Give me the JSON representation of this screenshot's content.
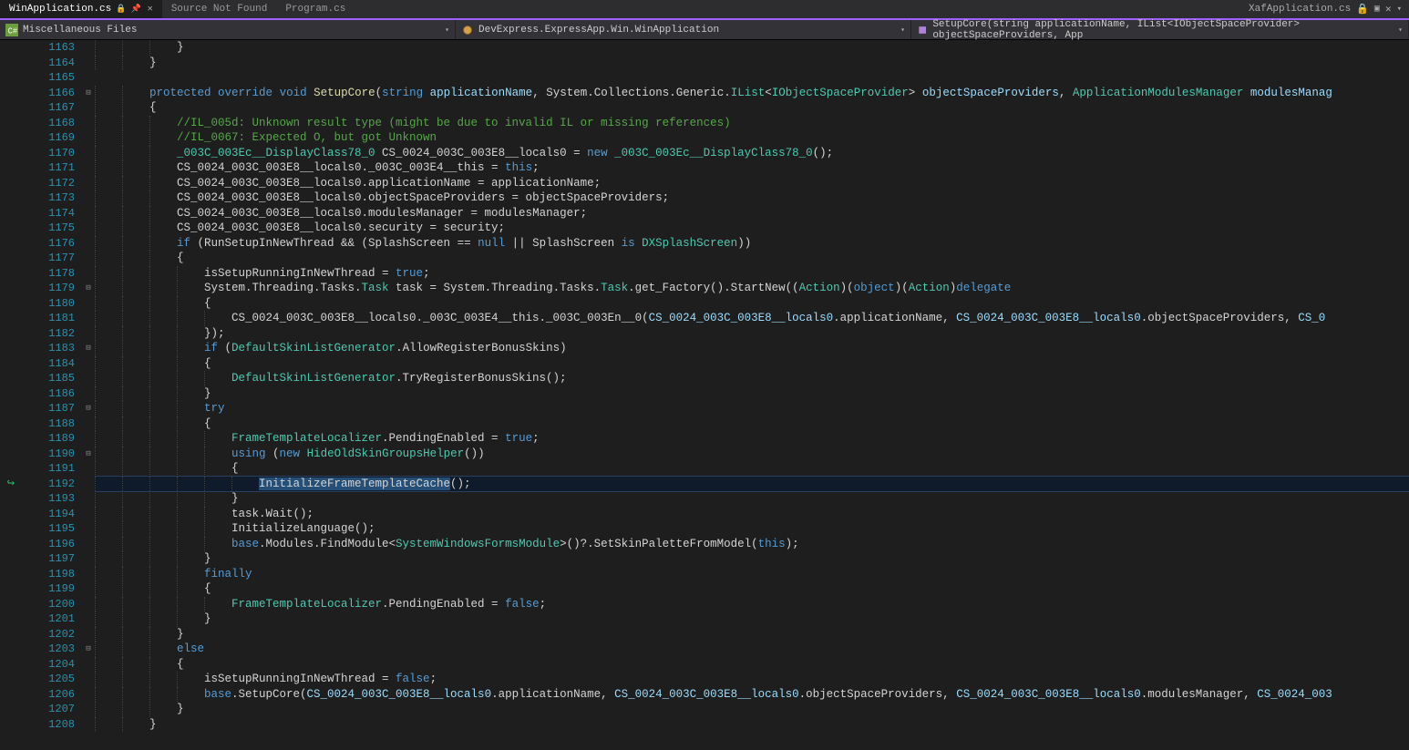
{
  "tabs": {
    "active": "WinApplication.cs",
    "items": [
      {
        "label": "WinApplication.cs",
        "active": true,
        "locked": true,
        "pinned": true
      },
      {
        "label": "Source Not Found",
        "active": false
      },
      {
        "label": "Program.cs",
        "active": false
      }
    ],
    "right": {
      "label": "XafApplication.cs",
      "locked": true
    }
  },
  "nav": {
    "project": "Miscellaneous Files",
    "class": "DevExpress.ExpressApp.Win.WinApplication",
    "method": "SetupCore(string applicationName, IList<IObjectSpaceProvider> objectSpaceProviders, App"
  },
  "icon_names": {
    "proj": "csharp-file-icon",
    "class": "class-icon",
    "method": "method-icon"
  },
  "code": {
    "first_line": 1163,
    "highlighted_line": 1192,
    "highlighted_text": "InitializeFrameTemplateCache",
    "fold_lines": [
      1166,
      1179,
      1183,
      1187,
      1190,
      1203
    ],
    "indicator_line": 1192,
    "lines": [
      {
        "n": 1163,
        "i": 3,
        "tok": [
          [
            "pl",
            "}"
          ]
        ]
      },
      {
        "n": 1164,
        "i": 2,
        "tok": [
          [
            "pl",
            "}"
          ]
        ]
      },
      {
        "n": 1165,
        "i": 0,
        "tok": []
      },
      {
        "n": 1166,
        "i": 2,
        "tok": [
          [
            "kw",
            "protected"
          ],
          [
            "pl",
            " "
          ],
          [
            "kw",
            "override"
          ],
          [
            "pl",
            " "
          ],
          [
            "kw",
            "void"
          ],
          [
            "pl",
            " "
          ],
          [
            "mc",
            "SetupCore"
          ],
          [
            "pl",
            "("
          ],
          [
            "kw",
            "string"
          ],
          [
            "pl",
            " "
          ],
          [
            "fld",
            "applicationName"
          ],
          [
            "pl",
            ", System.Collections.Generic."
          ],
          [
            "type",
            "IList"
          ],
          [
            "pl",
            "<"
          ],
          [
            "type",
            "IObjectSpaceProvider"
          ],
          [
            "pl",
            "> "
          ],
          [
            "fld",
            "objectSpaceProviders"
          ],
          [
            "pl",
            ", "
          ],
          [
            "type",
            "ApplicationModulesManager"
          ],
          [
            "pl",
            " "
          ],
          [
            "fld",
            "modulesManag"
          ]
        ]
      },
      {
        "n": 1167,
        "i": 2,
        "tok": [
          [
            "pl",
            "{"
          ]
        ]
      },
      {
        "n": 1168,
        "i": 3,
        "tok": [
          [
            "com",
            "//IL_005d: Unknown result type (might be due to invalid IL or missing references)"
          ]
        ]
      },
      {
        "n": 1169,
        "i": 3,
        "tok": [
          [
            "com",
            "//IL_0067: Expected O, but got Unknown"
          ]
        ]
      },
      {
        "n": 1170,
        "i": 3,
        "tok": [
          [
            "type",
            "_003C_003Ec__DisplayClass78_0"
          ],
          [
            "pl",
            " CS_0024_003C_003E8__locals0 = "
          ],
          [
            "kw",
            "new"
          ],
          [
            "pl",
            " "
          ],
          [
            "type",
            "_003C_003Ec__DisplayClass78_0"
          ],
          [
            "pl",
            "();"
          ]
        ]
      },
      {
        "n": 1171,
        "i": 3,
        "tok": [
          [
            "pl",
            "CS_0024_003C_003E8__locals0._003C_003E4__this = "
          ],
          [
            "kw",
            "this"
          ],
          [
            "pl",
            ";"
          ]
        ]
      },
      {
        "n": 1172,
        "i": 3,
        "tok": [
          [
            "pl",
            "CS_0024_003C_003E8__locals0.applicationName = applicationName;"
          ]
        ]
      },
      {
        "n": 1173,
        "i": 3,
        "tok": [
          [
            "pl",
            "CS_0024_003C_003E8__locals0.objectSpaceProviders = objectSpaceProviders;"
          ]
        ]
      },
      {
        "n": 1174,
        "i": 3,
        "tok": [
          [
            "pl",
            "CS_0024_003C_003E8__locals0.modulesManager = modulesManager;"
          ]
        ]
      },
      {
        "n": 1175,
        "i": 3,
        "tok": [
          [
            "pl",
            "CS_0024_003C_003E8__locals0.security = security;"
          ]
        ]
      },
      {
        "n": 1176,
        "i": 3,
        "tok": [
          [
            "kw",
            "if"
          ],
          [
            "pl",
            " (RunSetupInNewThread && (SplashScreen == "
          ],
          [
            "kw",
            "null"
          ],
          [
            "pl",
            " || SplashScreen "
          ],
          [
            "kw",
            "is"
          ],
          [
            "pl",
            " "
          ],
          [
            "type",
            "DXSplashScreen"
          ],
          [
            "pl",
            "))"
          ]
        ]
      },
      {
        "n": 1177,
        "i": 3,
        "tok": [
          [
            "pl",
            "{"
          ]
        ]
      },
      {
        "n": 1178,
        "i": 4,
        "tok": [
          [
            "pl",
            "isSetupRunningInNewThread = "
          ],
          [
            "kw",
            "true"
          ],
          [
            "pl",
            ";"
          ]
        ]
      },
      {
        "n": 1179,
        "i": 4,
        "tok": [
          [
            "pl",
            "System.Threading.Tasks."
          ],
          [
            "type",
            "Task"
          ],
          [
            "pl",
            " task = System.Threading.Tasks."
          ],
          [
            "type",
            "Task"
          ],
          [
            "pl",
            ".get_Factory().StartNew(("
          ],
          [
            "type",
            "Action"
          ],
          [
            "pl",
            ")("
          ],
          [
            "kw",
            "object"
          ],
          [
            "pl",
            ")("
          ],
          [
            "type",
            "Action"
          ],
          [
            "pl",
            ")"
          ],
          [
            "kw",
            "delegate"
          ]
        ]
      },
      {
        "n": 1180,
        "i": 4,
        "tok": [
          [
            "pl",
            "{"
          ]
        ]
      },
      {
        "n": 1181,
        "i": 5,
        "tok": [
          [
            "pl",
            "CS_0024_003C_003E8__locals0._003C_003E4__this._003C_003En__0("
          ],
          [
            "fld",
            "CS_0024_003C_003E8__locals0"
          ],
          [
            "pl",
            ".applicationName, "
          ],
          [
            "fld",
            "CS_0024_003C_003E8__locals0"
          ],
          [
            "pl",
            ".objectSpaceProviders, "
          ],
          [
            "fld",
            "CS_0"
          ]
        ]
      },
      {
        "n": 1182,
        "i": 4,
        "tok": [
          [
            "pl",
            "});"
          ]
        ]
      },
      {
        "n": 1183,
        "i": 4,
        "tok": [
          [
            "kw",
            "if"
          ],
          [
            "pl",
            " ("
          ],
          [
            "type",
            "DefaultSkinListGenerator"
          ],
          [
            "pl",
            ".AllowRegisterBonusSkins)"
          ]
        ]
      },
      {
        "n": 1184,
        "i": 4,
        "tok": [
          [
            "pl",
            "{"
          ]
        ]
      },
      {
        "n": 1185,
        "i": 5,
        "tok": [
          [
            "type",
            "DefaultSkinListGenerator"
          ],
          [
            "pl",
            ".TryRegisterBonusSkins();"
          ]
        ]
      },
      {
        "n": 1186,
        "i": 4,
        "tok": [
          [
            "pl",
            "}"
          ]
        ]
      },
      {
        "n": 1187,
        "i": 4,
        "tok": [
          [
            "kw",
            "try"
          ]
        ]
      },
      {
        "n": 1188,
        "i": 4,
        "tok": [
          [
            "pl",
            "{"
          ]
        ]
      },
      {
        "n": 1189,
        "i": 5,
        "tok": [
          [
            "type",
            "FrameTemplateLocalizer"
          ],
          [
            "pl",
            ".PendingEnabled = "
          ],
          [
            "kw",
            "true"
          ],
          [
            "pl",
            ";"
          ]
        ]
      },
      {
        "n": 1190,
        "i": 5,
        "tok": [
          [
            "kw",
            "using"
          ],
          [
            "pl",
            " ("
          ],
          [
            "kw",
            "new"
          ],
          [
            "pl",
            " "
          ],
          [
            "type",
            "HideOldSkinGroupsHelper"
          ],
          [
            "pl",
            "())"
          ]
        ]
      },
      {
        "n": 1191,
        "i": 5,
        "tok": [
          [
            "pl",
            "{"
          ]
        ]
      },
      {
        "n": 1192,
        "i": 6,
        "tok": [
          [
            "hl",
            "InitializeFrameTemplateCache"
          ],
          [
            "pl",
            "();"
          ]
        ]
      },
      {
        "n": 1193,
        "i": 5,
        "tok": [
          [
            "pl",
            "}"
          ]
        ]
      },
      {
        "n": 1194,
        "i": 5,
        "tok": [
          [
            "pl",
            "task.Wait();"
          ]
        ]
      },
      {
        "n": 1195,
        "i": 5,
        "tok": [
          [
            "pl",
            "InitializeLanguage();"
          ]
        ]
      },
      {
        "n": 1196,
        "i": 5,
        "tok": [
          [
            "kw",
            "base"
          ],
          [
            "pl",
            ".Modules.FindModule<"
          ],
          [
            "type",
            "SystemWindowsFormsModule"
          ],
          [
            "pl",
            ">()?.SetSkinPaletteFromModel("
          ],
          [
            "kw",
            "this"
          ],
          [
            "pl",
            ");"
          ]
        ]
      },
      {
        "n": 1197,
        "i": 4,
        "tok": [
          [
            "pl",
            "}"
          ]
        ]
      },
      {
        "n": 1198,
        "i": 4,
        "tok": [
          [
            "kw",
            "finally"
          ]
        ]
      },
      {
        "n": 1199,
        "i": 4,
        "tok": [
          [
            "pl",
            "{"
          ]
        ]
      },
      {
        "n": 1200,
        "i": 5,
        "tok": [
          [
            "type",
            "FrameTemplateLocalizer"
          ],
          [
            "pl",
            ".PendingEnabled = "
          ],
          [
            "kw",
            "false"
          ],
          [
            "pl",
            ";"
          ]
        ]
      },
      {
        "n": 1201,
        "i": 4,
        "tok": [
          [
            "pl",
            "}"
          ]
        ]
      },
      {
        "n": 1202,
        "i": 3,
        "tok": [
          [
            "pl",
            "}"
          ]
        ]
      },
      {
        "n": 1203,
        "i": 3,
        "tok": [
          [
            "kw",
            "else"
          ]
        ]
      },
      {
        "n": 1204,
        "i": 3,
        "tok": [
          [
            "pl",
            "{"
          ]
        ]
      },
      {
        "n": 1205,
        "i": 4,
        "tok": [
          [
            "pl",
            "isSetupRunningInNewThread = "
          ],
          [
            "kw",
            "false"
          ],
          [
            "pl",
            ";"
          ]
        ]
      },
      {
        "n": 1206,
        "i": 4,
        "tok": [
          [
            "kw",
            "base"
          ],
          [
            "pl",
            ".SetupCore("
          ],
          [
            "fld",
            "CS_0024_003C_003E8__locals0"
          ],
          [
            "pl",
            ".applicationName, "
          ],
          [
            "fld",
            "CS_0024_003C_003E8__locals0"
          ],
          [
            "pl",
            ".objectSpaceProviders, "
          ],
          [
            "fld",
            "CS_0024_003C_003E8__locals0"
          ],
          [
            "pl",
            ".modulesManager, "
          ],
          [
            "fld",
            "CS_0024_003"
          ]
        ]
      },
      {
        "n": 1207,
        "i": 3,
        "tok": [
          [
            "pl",
            "}"
          ]
        ]
      },
      {
        "n": 1208,
        "i": 2,
        "tok": [
          [
            "pl",
            "}"
          ]
        ]
      }
    ]
  }
}
